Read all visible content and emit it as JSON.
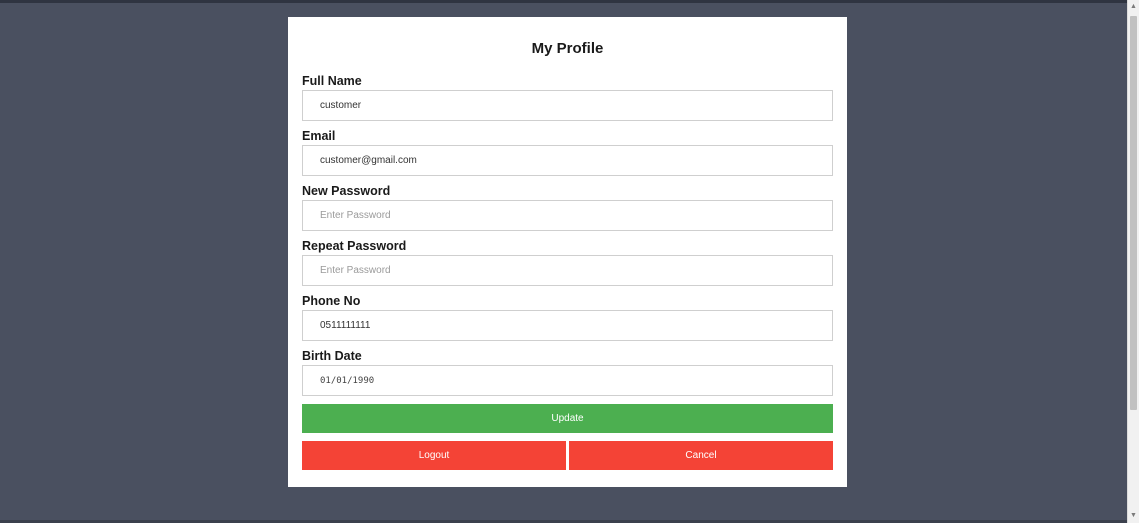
{
  "profile": {
    "title": "My Profile",
    "fields": {
      "full_name": {
        "label": "Full Name",
        "value": "customer"
      },
      "email": {
        "label": "Email",
        "value": "customer@gmail.com"
      },
      "new_password": {
        "label": "New Password",
        "placeholder": "Enter Password"
      },
      "repeat_password": {
        "label": "Repeat Password",
        "placeholder": "Enter Password"
      },
      "phone": {
        "label": "Phone No",
        "value": "0511111111"
      },
      "birth_date": {
        "label": "Birth Date",
        "value": "01/01/1990"
      }
    },
    "buttons": {
      "update": "Update",
      "logout": "Logout",
      "cancel": "Cancel"
    },
    "colors": {
      "update": "#4caf50",
      "logout": "#f44336",
      "cancel": "#f44336",
      "background": "#4a5060"
    }
  }
}
